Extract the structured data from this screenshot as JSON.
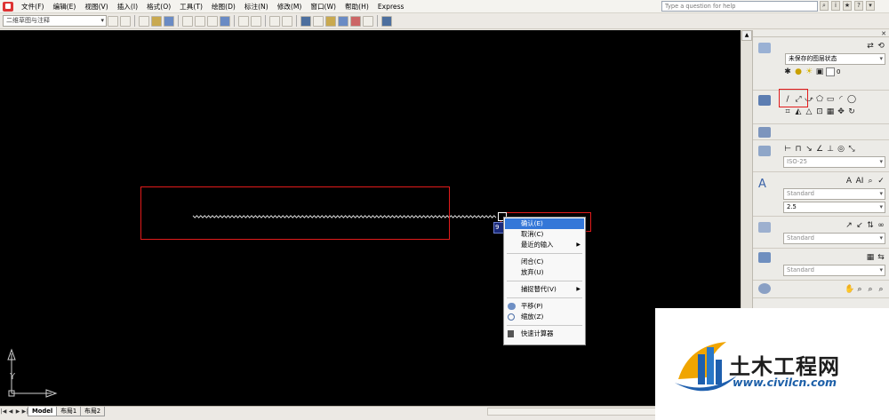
{
  "menubar": {
    "items": [
      "文件(F)",
      "编辑(E)",
      "视图(V)",
      "插入(I)",
      "格式(O)",
      "工具(T)",
      "绘图(D)",
      "标注(N)",
      "修改(M)",
      "窗口(W)",
      "帮助(H)",
      "Express"
    ],
    "help_placeholder": "Type a question for help"
  },
  "toolbar": {
    "workspace": "二维草图与注释"
  },
  "tabs": [
    "Model",
    "布局1",
    "布局2"
  ],
  "coord_tip": "9",
  "ucs": {
    "y": "Y",
    "x": "X"
  },
  "context_menu": {
    "items": [
      {
        "label": "确认(E)",
        "highlighted": true
      },
      {
        "label": "取消(C)"
      },
      {
        "label": "最近的输入",
        "submenu": true
      },
      {
        "label": "闭合(C)"
      },
      {
        "label": "放弃(U)"
      },
      {
        "label": "捕捉替代(V)",
        "submenu": true
      },
      {
        "label": "平移(P)",
        "icon": "pan-icon"
      },
      {
        "label": "缩放(Z)",
        "icon": "zoom-icon"
      },
      {
        "label": "快速计算器",
        "icon": "calculator-icon"
      }
    ]
  },
  "palette": {
    "layer_state": "未保存的图层状态",
    "layer_current": "0",
    "dim_style": "ISO-25",
    "text_style": "Standard",
    "text_height": "2.5",
    "mleader_style": "Standard",
    "table_style": "Standard"
  },
  "watermark": {
    "title": "土木工程网",
    "url": "www.civilcn.com"
  },
  "colors": {
    "canvas": "#000000",
    "highlight_box": "#e21b1b",
    "menu_highlight": "#3477d8",
    "watermark_url": "#1c5fa8"
  }
}
